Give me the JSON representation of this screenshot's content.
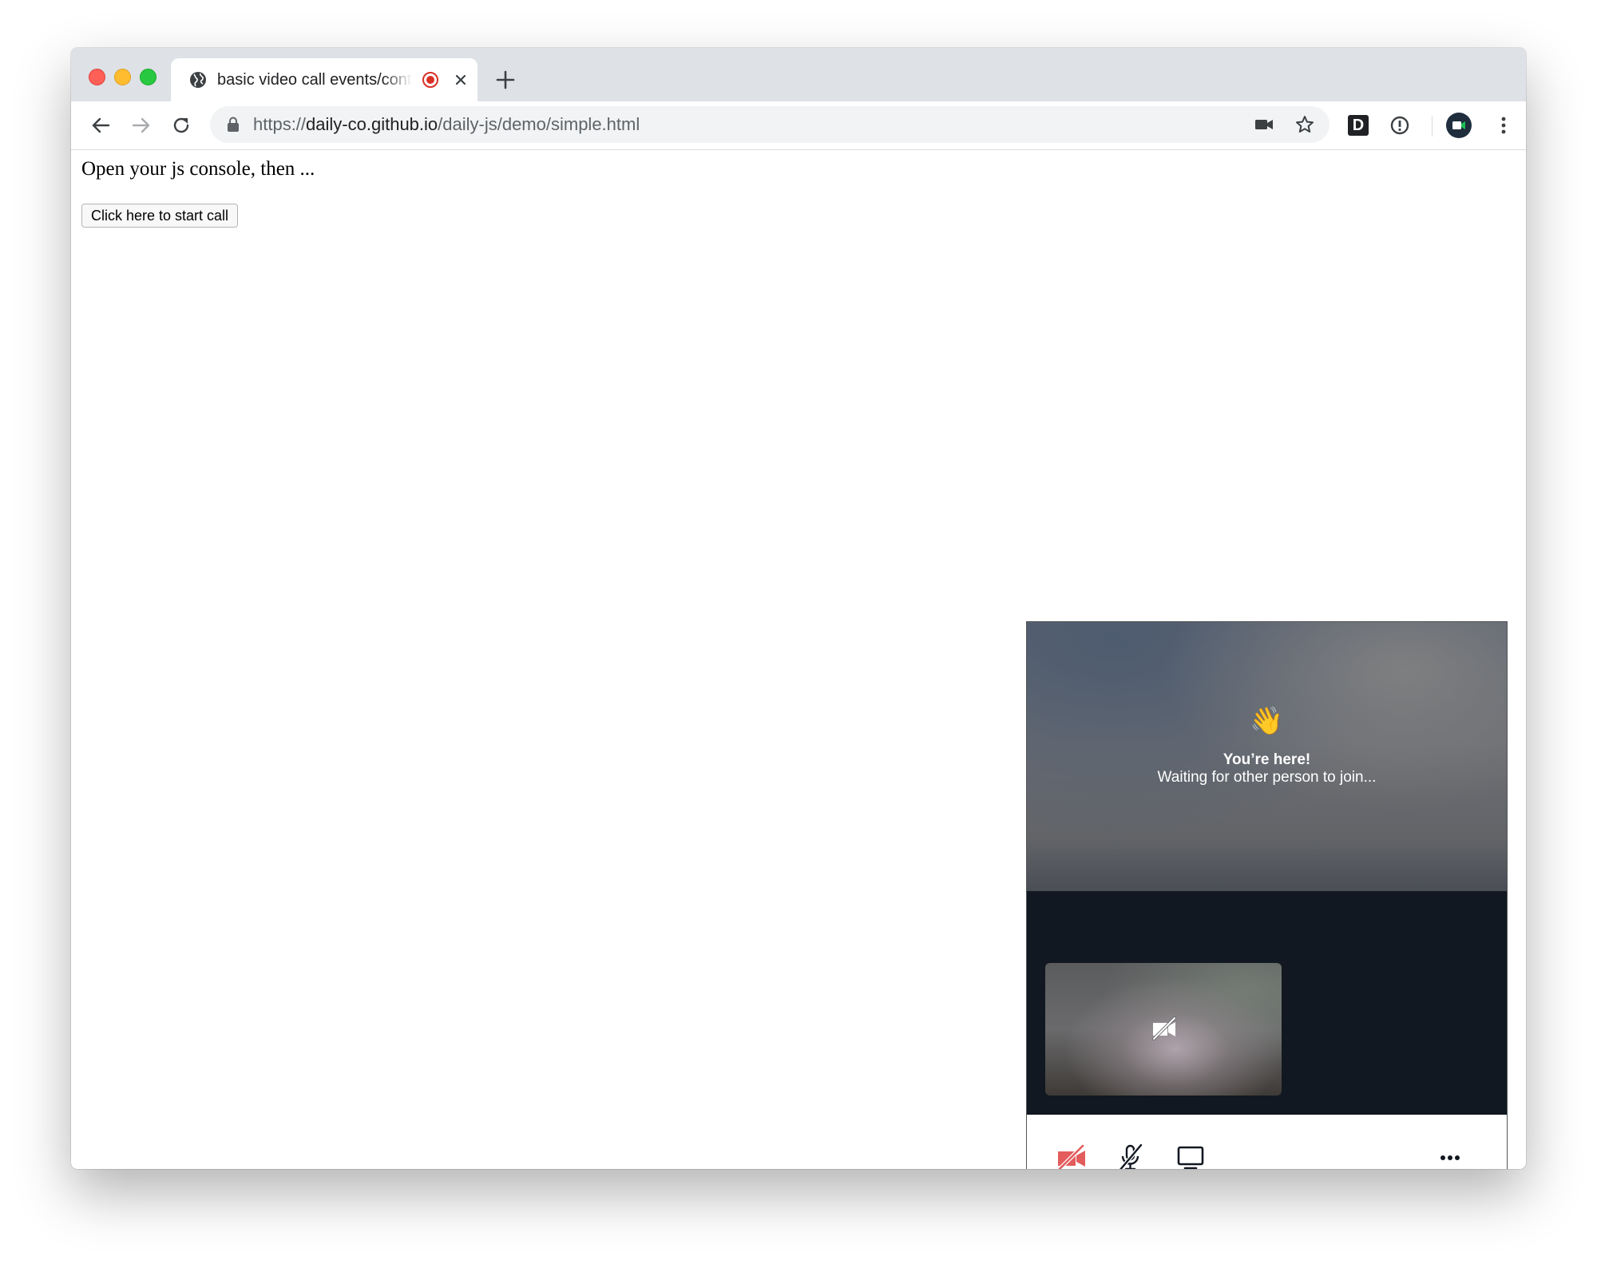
{
  "browser": {
    "tab": {
      "title": "basic video call events/controls",
      "icon": "globe-icon",
      "recording_indicator": "recording-icon",
      "close_icon": "close-icon"
    },
    "new_tab_icon": "plus-icon",
    "toolbar": {
      "back_icon": "arrow-left-icon",
      "forward_icon": "arrow-right-icon",
      "reload_icon": "reload-icon",
      "url_scheme": "https://",
      "url_host": "daily-co.github.io",
      "url_path": "/daily-js/demo/simple.html",
      "camera_icon": "video-camera-icon",
      "bookmark_icon": "star-icon",
      "extension_d_label": "D",
      "extension_info_icon": "info-circle-icon",
      "extension_daily_icon": "daily-video-icon",
      "menu_icon": "vertical-dots-icon"
    }
  },
  "page": {
    "intro_text": "Open your js console, then ...",
    "start_button_label": "Click here to start call"
  },
  "call": {
    "wave_emoji": "👋",
    "heading": "You’re here!",
    "waiting_text": "Waiting for other person to join...",
    "self_tile_icon": "camera-off-icon",
    "controls": {
      "camera_toggle_icon": "camera-off-icon",
      "mic_toggle_icon": "microphone-off-icon",
      "screenshare_icon": "monitor-icon",
      "more_icon": "more-horizontal-icon"
    },
    "colors": {
      "camera_off_red": "#e35d5d",
      "dark_background": "#121821"
    }
  }
}
